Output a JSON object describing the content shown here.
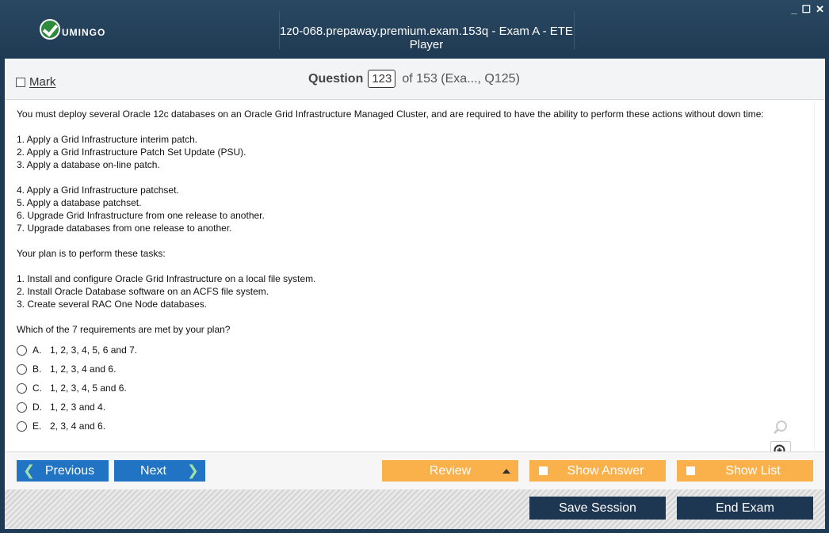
{
  "window": {
    "title": "1z0-068.prepaway.premium.exam.153q - Exam A - ETE Player",
    "logo_text": "UMINGO",
    "controls": [
      "_",
      "☐",
      "✕"
    ]
  },
  "header": {
    "mark_label": "Mark",
    "question_label": "Question",
    "question_number": "123",
    "question_of": "of 153 (Exa..., Q125)"
  },
  "question": {
    "intro": "You must deploy several Oracle 12c databases on an Oracle Grid Infrastructure Managed Cluster, and are required to have the ability to perform these actions without down time:",
    "req_group1": [
      "1. Apply a Grid Infrastructure interim patch.",
      "2. Apply a Grid Infrastructure Patch Set Update (PSU).",
      "3. Apply a database on-line patch."
    ],
    "req_group2": [
      "4. Apply a Grid Infrastructure patchset.",
      "5. Apply a database patchset.",
      "6. Upgrade Grid Infrastructure from one release to another.",
      "7. Upgrade databases from one release to another."
    ],
    "plan_intro": "Your plan is to perform these tasks:",
    "tasks": [
      "1. Install and configure Oracle Grid Infrastructure on a local file system.",
      "2. Install Oracle Database software on an ACFS file system.",
      "3. Create several RAC One Node databases."
    ],
    "prompt": "Which of the 7 requirements are met by your plan?",
    "options": [
      {
        "letter": "A.",
        "text": "1, 2, 3, 4, 5, 6 and 7."
      },
      {
        "letter": "B.",
        "text": "1, 2, 3, 4 and 6."
      },
      {
        "letter": "C.",
        "text": "1, 2, 3, 4, 5 and 6."
      },
      {
        "letter": "D.",
        "text": "1, 2, 3 and 4."
      },
      {
        "letter": "E.",
        "text": "2, 3, 4 and 6."
      }
    ]
  },
  "toolbar": {
    "previous": "Previous",
    "next": "Next",
    "review": "Review",
    "show_answer": "Show Answer",
    "show_list": "Show List",
    "save_session": "Save Session",
    "end_exam": "End Exam"
  },
  "colors": {
    "titlebar": "#1f3a53",
    "nav_blue": "#2173c3",
    "action_orange": "#fbb14b",
    "footer_dark": "#1d3651"
  }
}
